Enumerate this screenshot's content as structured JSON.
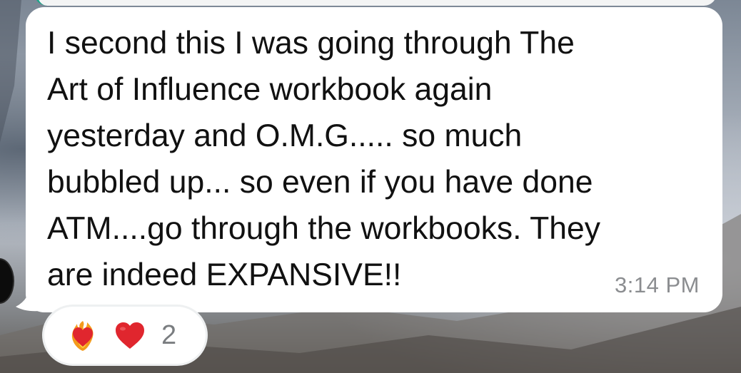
{
  "message": {
    "text": "I second this I was going through The\nArt of Influence workbook again\nyesterday and O.M.G..... so much\nbubbled up... so even if you have done\nATM....go through the workbooks. They\nare indeed EXPANSIVE!!",
    "timestamp": "3:14 PM"
  },
  "reactions": {
    "icons": [
      "heart-on-fire-icon",
      "red-heart-icon"
    ],
    "count": "2"
  },
  "colors": {
    "bubble": "#ffffff",
    "text": "#111111",
    "timestamp": "#8b8d90",
    "heart": "#e0262e",
    "quote_accent": "#1fa38a"
  }
}
